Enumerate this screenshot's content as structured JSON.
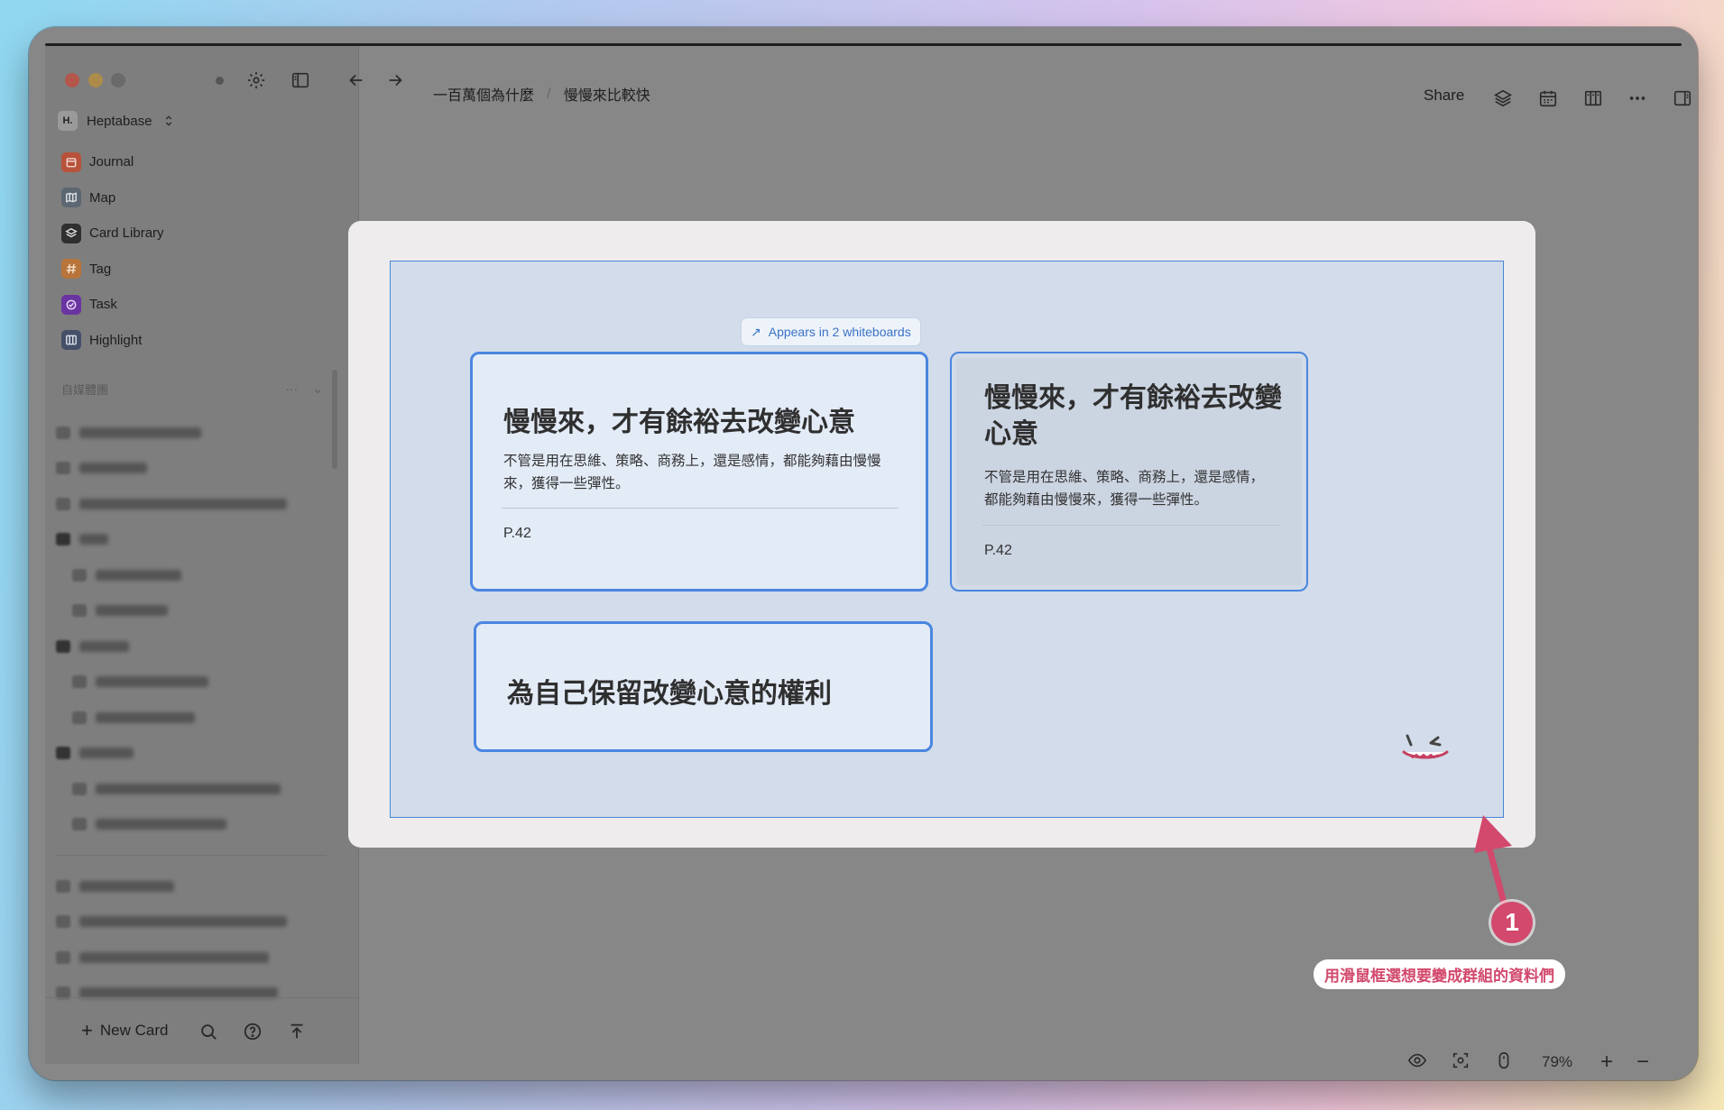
{
  "sidebar": {
    "workspace": {
      "badge": "H.",
      "name": "Heptabase"
    },
    "nav": [
      {
        "label": "Journal",
        "icon": "journal-icon",
        "color": "#b8523b"
      },
      {
        "label": "Map",
        "icon": "map-icon",
        "color": "#5d6772"
      },
      {
        "label": "Card Library",
        "icon": "card-library-icon",
        "color": "#2f2f2f"
      },
      {
        "label": "Tag",
        "icon": "tag-icon",
        "color": "#b8743b"
      },
      {
        "label": "Task",
        "icon": "task-icon",
        "color": "#6b34a3"
      },
      {
        "label": "Highlight",
        "icon": "highlight-icon",
        "color": "#44506a"
      }
    ],
    "section_title": "自媒體團",
    "new_card_label": "New Card"
  },
  "toolbar": {
    "breadcrumb": [
      "一百萬個為什麼",
      "慢慢來比較快"
    ],
    "share_label": "Share"
  },
  "whiteboard": {
    "appears_label": "Appears in 2 whiteboards",
    "cards": [
      {
        "title": "慢慢來，才有餘裕去改變心意",
        "body": "不管是用在思維、策略、商務上，還是感情，都能夠藉由慢慢來，獲得一些彈性。",
        "page": "P.42"
      },
      {
        "title": "慢慢來，才有餘裕去改變心意",
        "body": "不管是用在思維、策略、商務上，還是感情，都能夠藉由慢慢來，獲得一些彈性。",
        "page": "P.42"
      },
      {
        "title": "為自己保留改變心意的權利"
      }
    ]
  },
  "bottom_bar": {
    "zoom": "79%"
  },
  "annotation": {
    "number": "1",
    "label": "用滑鼠框選想要變成群組的資料們",
    "color": "#d2496d"
  }
}
